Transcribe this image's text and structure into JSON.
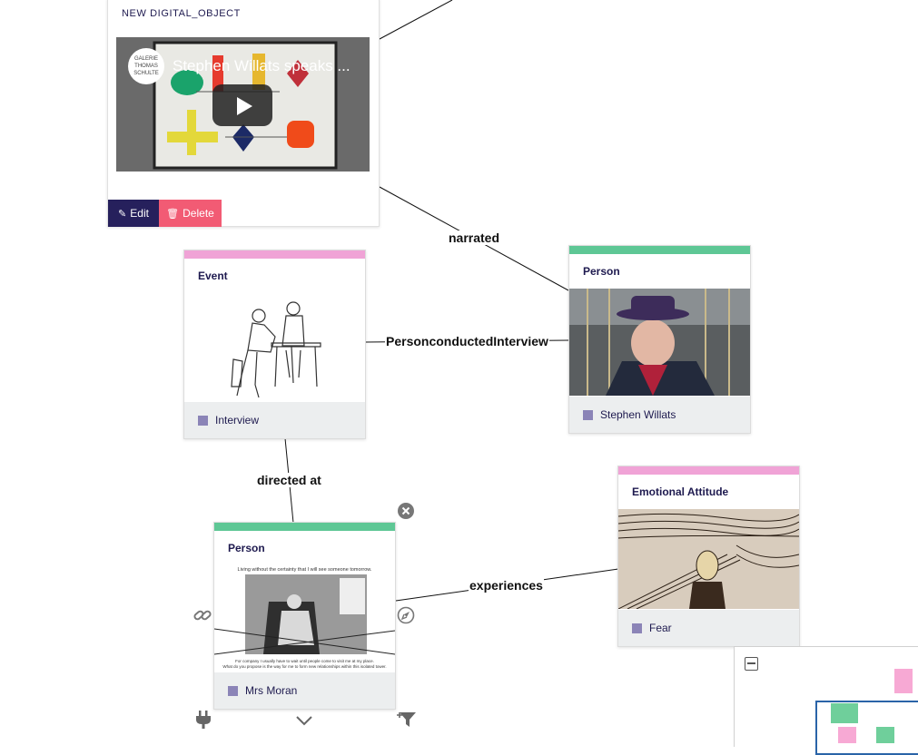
{
  "digital_object": {
    "title": "NEW DIGITAL_OBJECT",
    "video_title": "Stephen Willats speaks ...",
    "gallery_logo": "GALERIE THOMAS SCHULTE",
    "edit_label": "Edit",
    "delete_label": "Delete"
  },
  "nodes": {
    "event": {
      "type": "Event",
      "label": "Interview",
      "color": "#f0a3d6"
    },
    "person_willats": {
      "type": "Person",
      "label": "Stephen Willats",
      "color": "#5ec795"
    },
    "person_moran": {
      "type": "Person",
      "label": "Mrs Moran",
      "color": "#5ec795",
      "image_caption_top": "Living without the certainty that I will see someone tomorrow.",
      "image_caption_bottom_1": "For company I usually have to wait until people come to visit me at my place.",
      "image_caption_bottom_2": "What do you propose is the way for me to form new relationships within this isolated tower."
    },
    "emotional": {
      "type": "Emotional Attitude",
      "label": "Fear",
      "color": "#f0a3d6"
    }
  },
  "edges": {
    "narrated": "narrated",
    "person_conducted_interview": "PersonconductedInterview",
    "directed_at": "directed at",
    "experiences": "experiences"
  },
  "colors": {
    "accent_dark": "#26205c",
    "delete": "#f25b74",
    "type_text": "#1e1a4f",
    "marker": "#8b84b7"
  },
  "icons": [
    "close-icon",
    "link-icon",
    "navigate-icon",
    "plug-icon",
    "chevron-down-icon",
    "filter-add-icon",
    "pencil-icon",
    "trash-icon",
    "play-icon",
    "minus-square-icon"
  ]
}
